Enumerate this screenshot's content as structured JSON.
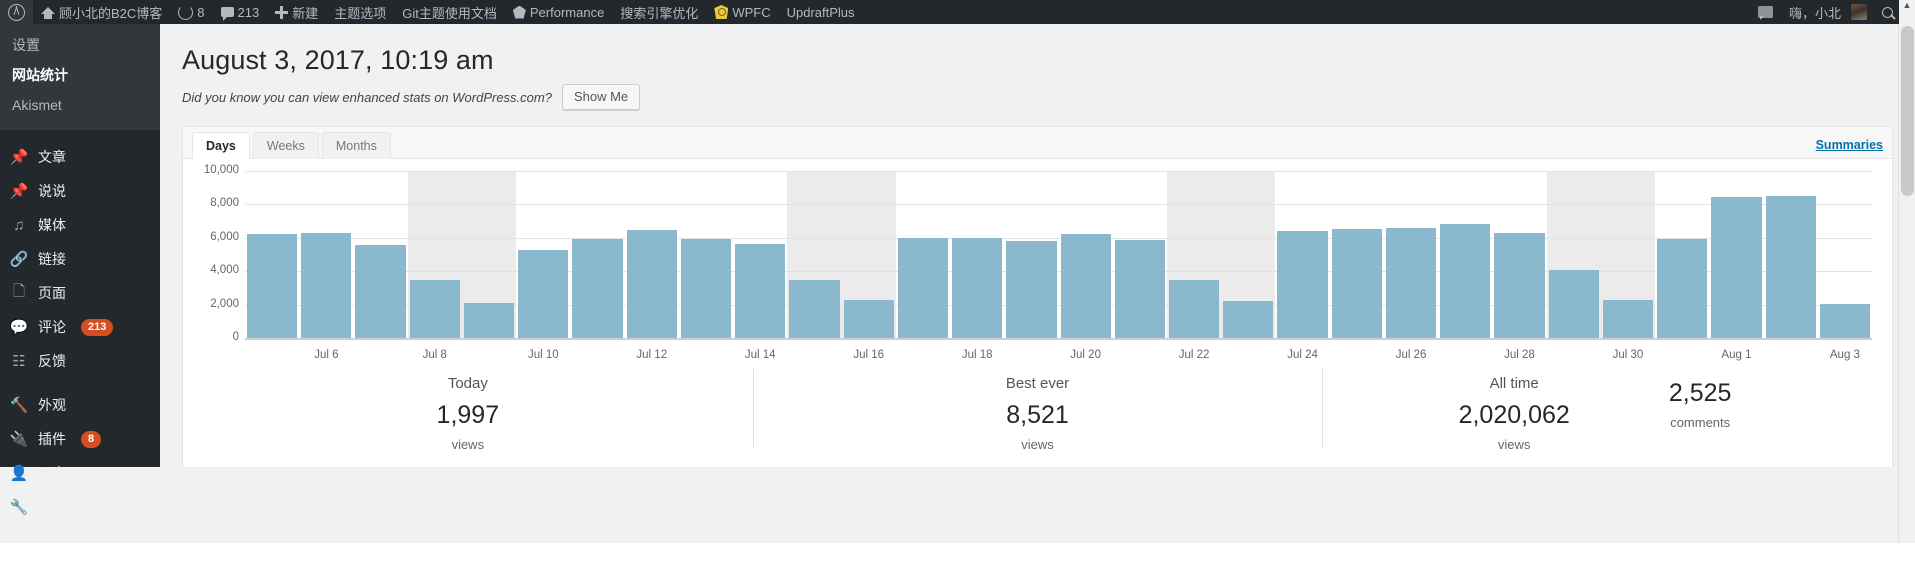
{
  "adminbar": {
    "items": [
      {
        "icon": "wordpress-logo-icon",
        "label": ""
      },
      {
        "icon": "home-icon",
        "label": "顾小北的B2C博客"
      },
      {
        "icon": "updates-icon",
        "label": "8"
      },
      {
        "icon": "comment-icon",
        "label": "213"
      },
      {
        "icon": "plus-icon",
        "label": "新建"
      },
      {
        "icon": "",
        "label": "主题选项"
      },
      {
        "icon": "",
        "label": "Git主题使用文档"
      },
      {
        "icon": "performance-icon",
        "label": "Performance"
      },
      {
        "icon": "",
        "label": "搜索引擎优化"
      },
      {
        "icon": "wpfc-icon",
        "label": "WPFC"
      },
      {
        "icon": "",
        "label": "UpdraftPlus"
      }
    ],
    "notification_icon": "comment-bubble-icon",
    "howdy": "嗨，小北",
    "avatar": "user-avatar",
    "search_icon": "search-icon"
  },
  "sidebar": {
    "submenu": [
      {
        "label": "设置",
        "current": false
      },
      {
        "label": "网站统计",
        "current": true
      },
      {
        "label": "Akismet",
        "current": false
      }
    ],
    "menu": [
      {
        "icon": "pin-icon",
        "label": "文章",
        "badge": ""
      },
      {
        "icon": "pin-icon",
        "label": "说说",
        "badge": ""
      },
      {
        "icon": "media-icon",
        "label": "媒体",
        "badge": ""
      },
      {
        "icon": "link-icon",
        "label": "链接",
        "badge": ""
      },
      {
        "icon": "pages-icon",
        "label": "页面",
        "badge": ""
      },
      {
        "icon": "comment-icon",
        "label": "评论",
        "badge": "213"
      },
      {
        "icon": "feedback-icon",
        "label": "反馈",
        "badge": ""
      },
      {
        "icon": "appearance-icon",
        "label": "外观",
        "badge": "",
        "group_start": true
      },
      {
        "icon": "plugin-icon",
        "label": "插件",
        "badge": "8"
      },
      {
        "icon": "user-icon",
        "label": "用户",
        "badge": ""
      },
      {
        "icon": "tools-icon",
        "label": "工具",
        "badge": ""
      }
    ]
  },
  "main": {
    "page_title": "August 3, 2017, 10:19 am",
    "promo_text": "Did you know you can view enhanced stats on WordPress.com?",
    "show_me_label": "Show Me",
    "tabs": [
      {
        "label": "Days",
        "active": true
      },
      {
        "label": "Weeks",
        "active": false
      },
      {
        "label": "Months",
        "active": false
      }
    ],
    "summaries_label": "Summaries"
  },
  "chart_data": {
    "type": "bar",
    "title": "",
    "xlabel": "",
    "ylabel": "",
    "ylim": [
      0,
      10000
    ],
    "yticks": [
      0,
      2000,
      4000,
      6000,
      8000,
      10000
    ],
    "ytick_labels": [
      "0",
      "2,000",
      "4,000",
      "6,000",
      "8,000",
      "10,000"
    ],
    "grid": true,
    "legend": "none",
    "bar_color": "#8ab8cd",
    "weekend_band_color": "#ebebeb",
    "categories": [
      "Jul 5",
      "Jul 6",
      "Jul 7",
      "Jul 8",
      "Jul 9",
      "Jul 10",
      "Jul 11",
      "Jul 12",
      "Jul 13",
      "Jul 14",
      "Jul 15",
      "Jul 16",
      "Jul 17",
      "Jul 18",
      "Jul 19",
      "Jul 20",
      "Jul 21",
      "Jul 22",
      "Jul 23",
      "Jul 24",
      "Jul 25",
      "Jul 26",
      "Jul 27",
      "Jul 28",
      "Jul 29",
      "Jul 30",
      "Jul 31",
      "Aug 1",
      "Aug 2",
      "Aug 3"
    ],
    "values": [
      6250,
      6270,
      5550,
      3450,
      2070,
      5250,
      5900,
      6450,
      5950,
      5600,
      3500,
      2250,
      6000,
      6000,
      5800,
      6250,
      5850,
      3450,
      2200,
      6400,
      6550,
      6600,
      6850,
      6300,
      4050,
      2250,
      5950,
      8450,
      8500,
      2050
    ],
    "xtick_labels": [
      "Jul 6",
      "Jul 8",
      "Jul 10",
      "Jul 12",
      "Jul 14",
      "Jul 16",
      "Jul 18",
      "Jul 20",
      "Jul 22",
      "Jul 24",
      "Jul 26",
      "Jul 28",
      "Jul 30",
      "Aug 1",
      "Aug 3"
    ],
    "weekend_bands": [
      [
        3,
        4
      ],
      [
        10,
        11
      ],
      [
        17,
        18
      ],
      [
        24,
        25
      ]
    ]
  },
  "stats": {
    "groups": [
      {
        "label": "Today",
        "items": [
          {
            "value": "1,997",
            "unit": "views"
          }
        ]
      },
      {
        "label": "Best ever",
        "items": [
          {
            "value": "8,521",
            "unit": "views"
          }
        ]
      },
      {
        "label": "All time",
        "items": [
          {
            "value": "2,020,062",
            "unit": "views"
          },
          {
            "value": "2,525",
            "unit": "comments"
          }
        ]
      }
    ]
  }
}
